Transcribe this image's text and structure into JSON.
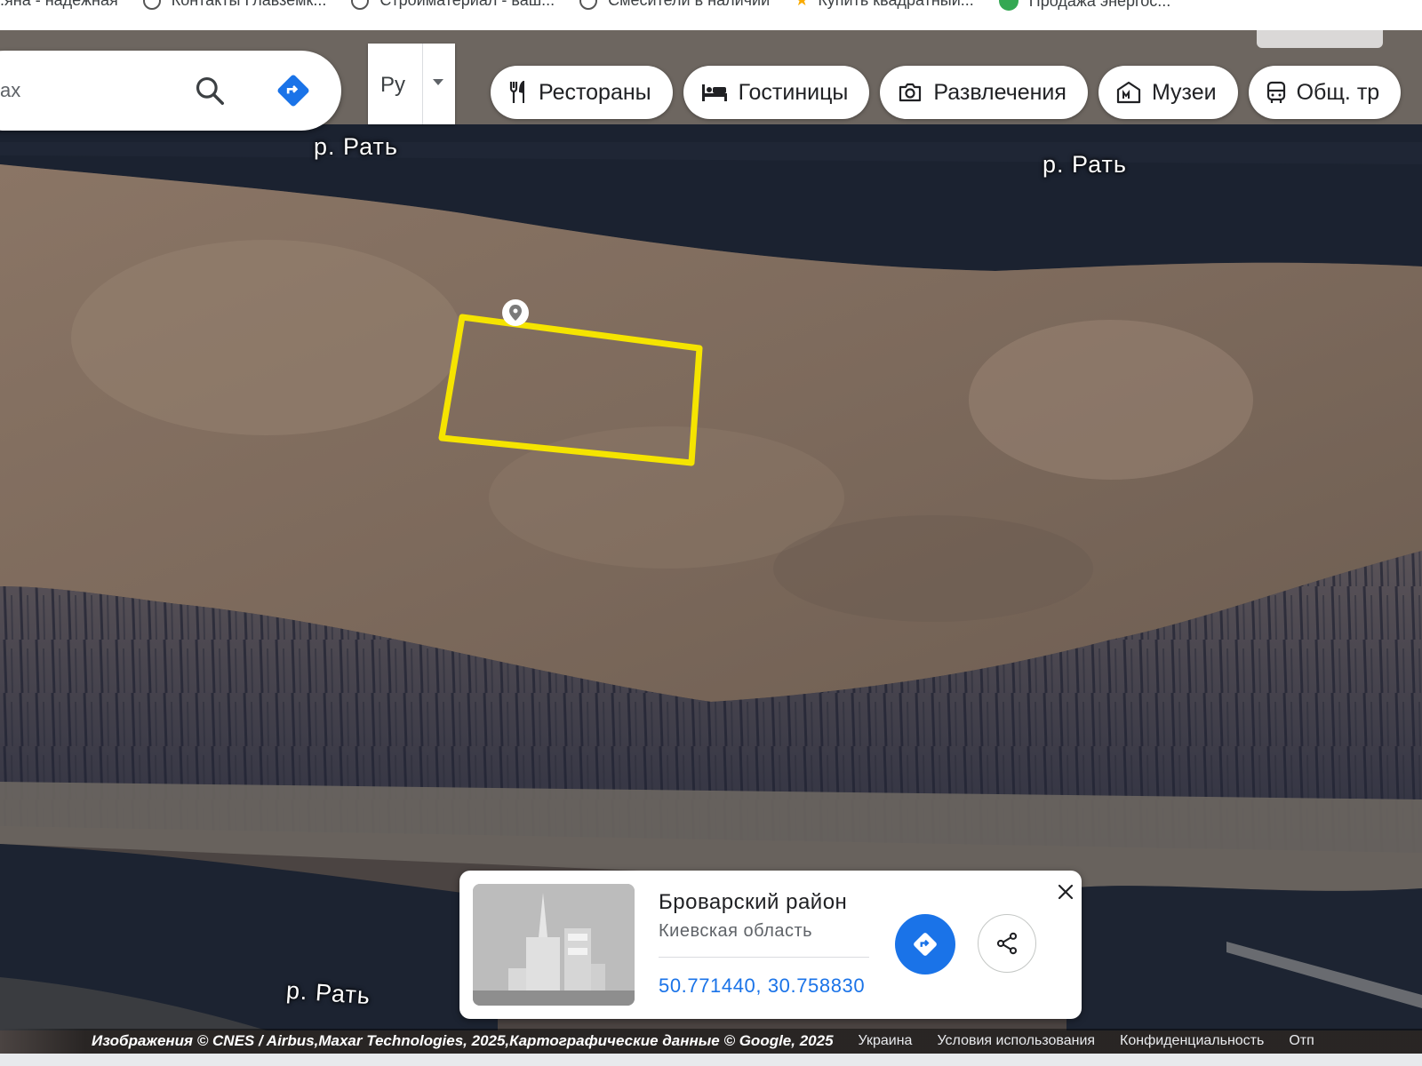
{
  "bookmarks": [
    {
      "label": "...яна - надежная",
      "icon": "none"
    },
    {
      "label": "Контакты Главземк...",
      "icon": "globe-icon"
    },
    {
      "label": "Стройматериал - ваш...",
      "icon": "globe-icon"
    },
    {
      "label": "Смесители в наличии",
      "icon": "globe-icon"
    },
    {
      "label": "Купить квадратный...",
      "icon": "star-icon"
    },
    {
      "label": "Продажа энергос...",
      "icon": "green-dot-icon"
    }
  ],
  "search": {
    "text": "ах",
    "icons": [
      "search-icon",
      "directions-icon"
    ]
  },
  "language": {
    "value": "Ру"
  },
  "chips": [
    {
      "label": "Рестораны",
      "icon": "restaurant-icon"
    },
    {
      "label": "Гостиницы",
      "icon": "hotel-icon"
    },
    {
      "label": "Развлечения",
      "icon": "camera-icon"
    },
    {
      "label": "Музеи",
      "icon": "museum-icon"
    },
    {
      "label": "Общ. тр",
      "icon": "transit-icon"
    }
  ],
  "map": {
    "type": "satellite",
    "river_labels": [
      "р. Рать",
      "р. Рать",
      "р. Рать"
    ],
    "colors": {
      "parcel_outline": "#f5e400",
      "water": "#1b2230",
      "field": "#86705f"
    }
  },
  "card": {
    "title": "Броварский район",
    "subtitle": "Киевская область",
    "coordinates": "50.771440, 30.758830",
    "buttons": [
      "directions-icon",
      "share-icon",
      "close-icon"
    ],
    "accent": "#1a73e8"
  },
  "footer": {
    "attribution": "Изображения © CNES / Airbus,Maxar Technologies, 2025,Картографические данные © Google, 2025",
    "links": [
      "Украина",
      "Условия использования",
      "Конфиденциальность",
      "Отп"
    ]
  }
}
